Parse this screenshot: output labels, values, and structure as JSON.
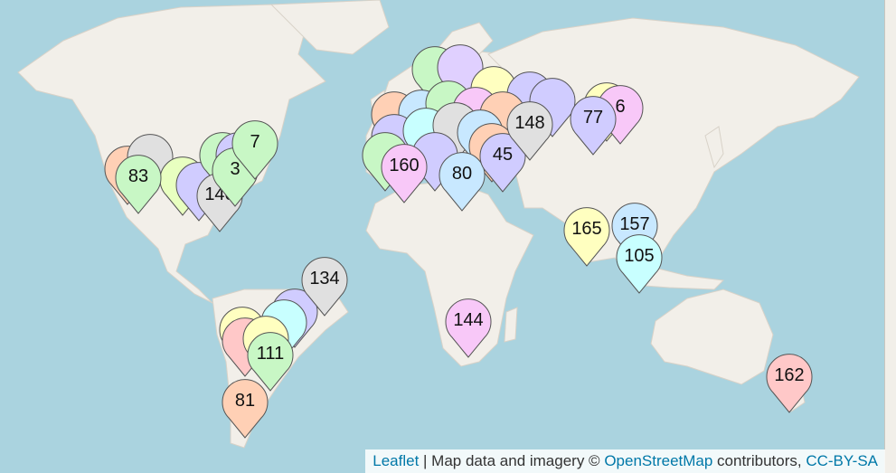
{
  "map": {
    "water_color": "#aad3df",
    "land_color": "#f2efe9",
    "border_color": "#c8b2c6"
  },
  "attribution": {
    "leaflet_link": "Leaflet",
    "separator": " | Map data and imagery © ",
    "osm_link": "OpenStreetMap",
    "contributors": " contributors, ",
    "license_link": "CC-BY-SA"
  },
  "markers": [
    {
      "label": "83",
      "color": "#ffd0b5"
    },
    {
      "label": "140",
      "color": "#e0e0e0"
    },
    {
      "label": "3",
      "color": "#c8f7c5"
    },
    {
      "label": "7",
      "color": "#c8f7c5"
    },
    {
      "label": "160",
      "color": "#f8c8f8"
    },
    {
      "label": "80",
      "color": "#c8e8ff"
    },
    {
      "label": "45",
      "color": "#d0ccff"
    },
    {
      "label": "148",
      "color": "#e0e0e0"
    },
    {
      "label": "77",
      "color": "#d0ccff"
    },
    {
      "label": "6",
      "color": "#f8c8f8"
    },
    {
      "label": "165",
      "color": "#ffffc0"
    },
    {
      "label": "157",
      "color": "#c8e8ff"
    },
    {
      "label": "105",
      "color": "#c8ffff"
    },
    {
      "label": "134",
      "color": "#e0e0e0"
    },
    {
      "label": "111",
      "color": "#c8f7c5"
    },
    {
      "label": "81",
      "color": "#ffd0b5"
    },
    {
      "label": "144",
      "color": "#f8c8f8"
    },
    {
      "label": "162",
      "color": "#ffc8c8"
    }
  ]
}
